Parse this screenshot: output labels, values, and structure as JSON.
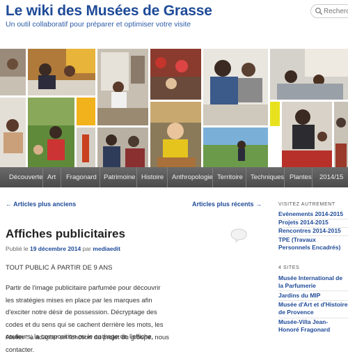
{
  "site": {
    "title": "Le wiki des Musées de Grasse",
    "description": "Un outil collaboratif pour préparer et optimiser votre visite",
    "search_placeholder": "Recherche"
  },
  "nav": {
    "items": [
      "Découverte",
      "Art",
      "Fragonard",
      "Patrimoine",
      "Histoire",
      "Anthropologie",
      "Territoire",
      "Techniques",
      "Plantes",
      "2014/15"
    ]
  },
  "post_nav": {
    "older": "← Articles plus anciens",
    "newer": "Articles plus récents →"
  },
  "entry": {
    "title": "Affiches publicitaires",
    "meta_prefix": "Publié le",
    "date": "19 décembre 2014",
    "meta_by": "par",
    "author": "mediaedit",
    "p1": "TOUT PUBLIC À PARTIR DE 9 ANS",
    "p2": "Partir de l'image publicitaire parfumée pour découvrir les stratégies mises en place par les marques afin d'exciter notre désir de possession. Décryptage des codes et du sens qui se cachent derrière les mots, les couleurs, la composition ou le cadrage de l'affiche.",
    "p3": "Atelier : à adapter en fonction du projet du groupe, nous contacter."
  },
  "sidebar": {
    "widget1_title": "VISITEZ AUTREMENT",
    "widget1_items": [
      "Evènements 2014-2015",
      "Projets 2014-2015",
      "Rencontres 2014-2015",
      "TPE (Travaux Personnels Encadrés)"
    ],
    "widget2_title": "4 SITES",
    "widget2_items": [
      "Musée International de la Parfumerie",
      "Jardins du MIP",
      "Musée d'Art et d'Histoire de Provence",
      "Musée-Villa Jean-Honoré Fragonard"
    ]
  },
  "colors": {
    "link": "#1e4a98",
    "nav_bg": "#555555",
    "accent_yellow": "#f2b21b"
  }
}
